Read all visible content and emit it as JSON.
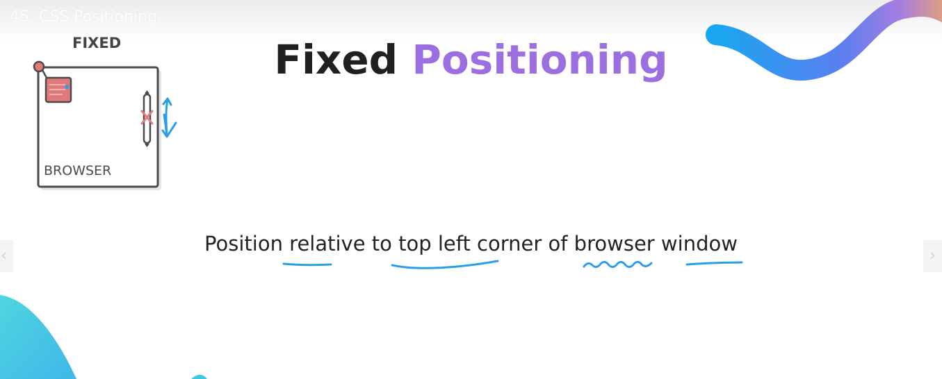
{
  "video": {
    "title": "45. CSS Positioning"
  },
  "slide": {
    "title_part1": "Fixed",
    "title_part2": "Positioning",
    "subtitle": "Position relative to top left corner of browser window",
    "diagram": {
      "heading": "FIXED",
      "box_label": "BROWSER"
    }
  },
  "navigation": {
    "prev_icon": "chevron-left-icon",
    "next_icon": "chevron-right-icon",
    "prev_glyph": "‹",
    "next_glyph": "›"
  },
  "colors": {
    "title_dark": "#202020",
    "title_accent": "#9b6fe0",
    "underline_blue": "#2a9ee6",
    "element_red": "#e07a7a",
    "blob_cyan": "#4dd4df"
  }
}
